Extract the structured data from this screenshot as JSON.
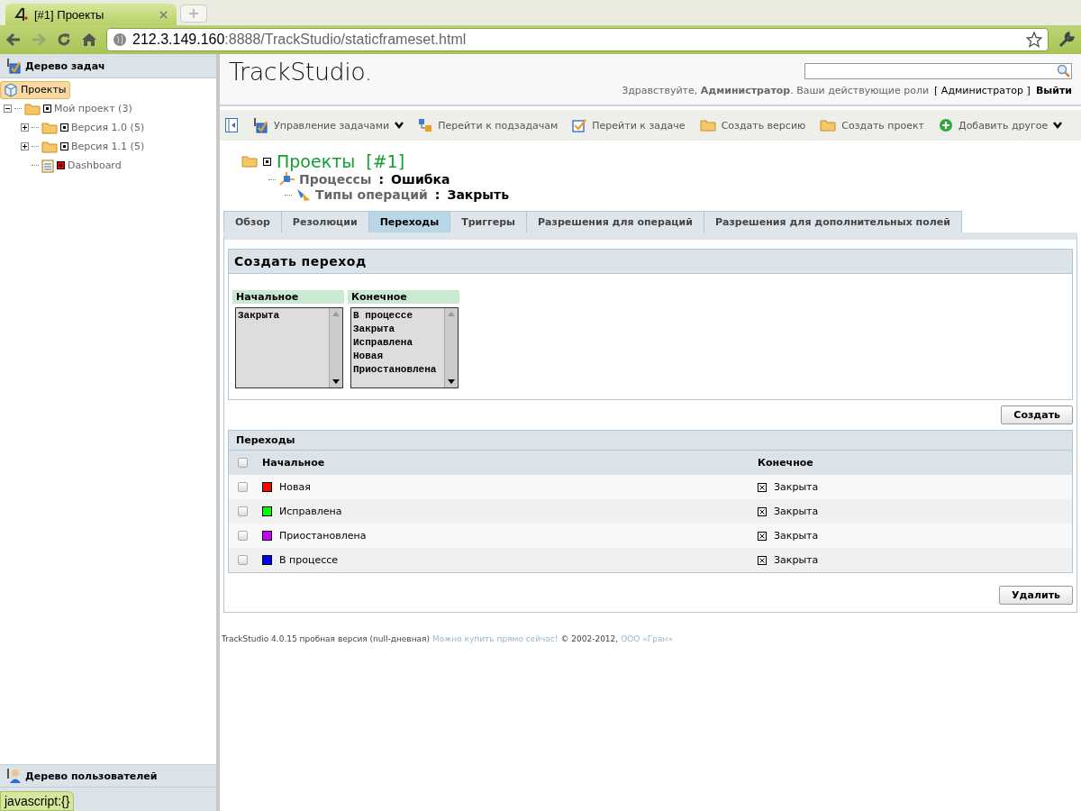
{
  "browser": {
    "tab_title": "[#1] Проекты",
    "url_host": "212.3.149.160",
    "url_rest": ":8888/TrackStudio/staticframeset.html"
  },
  "task_tree": {
    "title": "Дерево задач",
    "items": [
      {
        "label": "Проекты",
        "kind": "root",
        "selected": true,
        "children": [
          {
            "label": "Мой проект (3)",
            "kind": "folder",
            "expanded": true,
            "selected": false,
            "children": [
              {
                "label": "Версия 1.0 (5)",
                "kind": "folder",
                "expanded": false,
                "selected": false
              },
              {
                "label": "Версия 1.1 (5)",
                "kind": "folder",
                "expanded": false,
                "selected": false
              },
              {
                "label": "Dashboard",
                "kind": "report",
                "selected": false
              }
            ]
          }
        ]
      }
    ]
  },
  "user_tree": {
    "title": "Дерево пользователей"
  },
  "status_bubble": "javascript:{}",
  "header": {
    "logo": "TrackStudio",
    "logo_dot": ".",
    "greeting": "Здравствуйте, **Администратор**. Ваши действующие роли",
    "roles": "[ Администратор ]",
    "logout": "Выйти"
  },
  "toolbar": [
    {
      "label": "Управление задачами",
      "kind": "tools",
      "dropdown": true
    },
    {
      "label": "Перейти к подзадачам",
      "kind": "subtasks",
      "dropdown": false
    },
    {
      "label": "Перейти к задаче",
      "kind": "check",
      "dropdown": false
    },
    {
      "label": "Создать версию",
      "kind": "folder",
      "dropdown": false
    },
    {
      "label": "Создать проект",
      "kind": "folder",
      "dropdown": false
    },
    {
      "label": "Добавить другое",
      "kind": "plus",
      "dropdown": true
    }
  ],
  "breadcrumb": {
    "title": "Проекты",
    "number": "[#1]",
    "lines": [
      {
        "label": "Процессы",
        "sep": ":",
        "value": "Ошибка",
        "kind": "process"
      },
      {
        "label": "Типы операций",
        "sep": ":",
        "value": "Закрыть",
        "kind": "operation"
      }
    ]
  },
  "tabs": [
    {
      "label": "Обзор",
      "selected": false
    },
    {
      "label": "Резолюции",
      "selected": false
    },
    {
      "label": "Переходы",
      "selected": true
    },
    {
      "label": "Триггеры",
      "selected": false
    },
    {
      "label": "Разрешения для операций",
      "selected": false
    },
    {
      "label": "Разрешения для дополнительных полей",
      "selected": false
    }
  ],
  "create_transition": {
    "title": "Создать переход",
    "lists": [
      {
        "label": "Начальное",
        "options": [
          "Закрыта"
        ]
      },
      {
        "label": "Конечное",
        "options": [
          "В процессе",
          "Закрыта",
          "Исправлена",
          "Новая",
          "Приостановлена"
        ]
      }
    ],
    "button": "Создать"
  },
  "transitions": {
    "title": "Переходы",
    "select_all_checked": false,
    "columns": [
      "Начальное",
      "Конечное"
    ],
    "rows": [
      {
        "from": "Новая",
        "color": "#ff0000",
        "to": "Закрыта",
        "checked": false
      },
      {
        "from": "Исправлена",
        "color": "#00ff00",
        "to": "Закрыта",
        "checked": false
      },
      {
        "from": "Приостановлена",
        "color": "#cc00ff",
        "to": "Закрыта",
        "checked": false
      },
      {
        "from": "В процессе",
        "color": "#0000ff",
        "to": "Закрыта",
        "checked": false
      }
    ],
    "button": "Удалить"
  },
  "footer": {
    "text": "TrackStudio 4.0.15 пробная версия (null-дневная)",
    "buy_link": "Можно купить прямо сейчас!",
    "copyright": "© 2002-2012,",
    "company_link": "ООО «Гран»"
  }
}
